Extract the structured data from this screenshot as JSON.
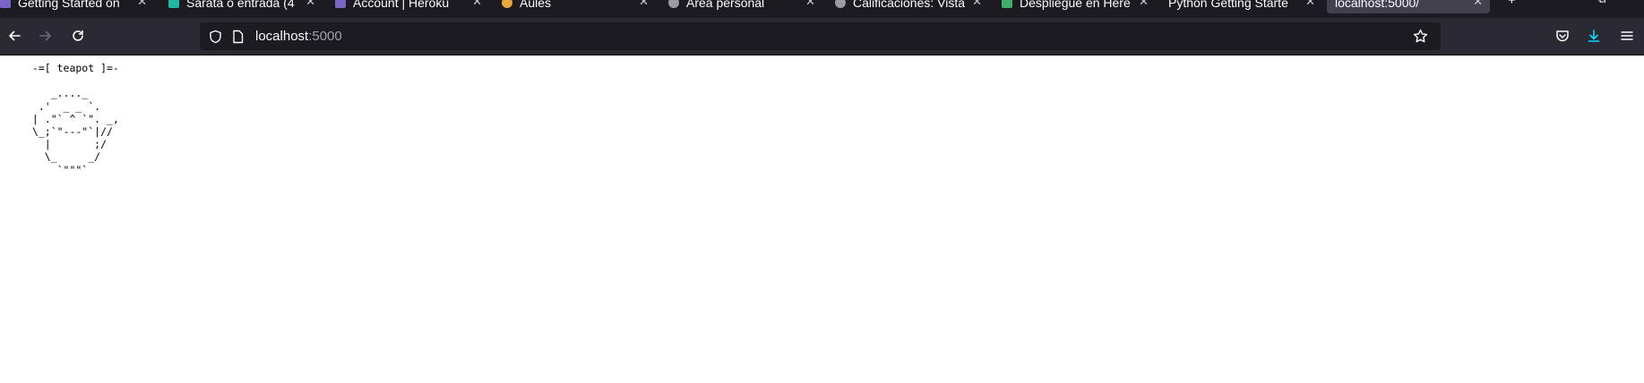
{
  "browser": {
    "tabs": [
      {
        "title": "Getting Started on",
        "favicon_color": "#7b63c7"
      },
      {
        "title": "Sarata o entrada (4",
        "favicon_color": "#22b5a0"
      },
      {
        "title": "Account | Heroku",
        "favicon_color": "#7b63c7"
      },
      {
        "title": "Aules",
        "favicon_color": "#e8a93c"
      },
      {
        "title": "Àrea personal",
        "favicon_color": "#9b9ba5"
      },
      {
        "title": "Calificaciones: Vista",
        "favicon_color": "#9b9ba5"
      },
      {
        "title": "Despliegue en Here",
        "favicon_color": "#3fae6a"
      },
      {
        "title": "Python Getting Starte",
        "favicon_color": ""
      },
      {
        "title": "localhost:5000/",
        "favicon_color": "",
        "active": true
      }
    ],
    "new_tab_label": "+",
    "url": {
      "host": "localhost",
      "port": ":5000"
    },
    "colors": {
      "download_accent": "#00ddff"
    }
  },
  "page": {
    "teapot_art": " -=[ teapot ]=-\n\n    _...._\n  .'  _ _ `.\n | .\"` ^ `\". _,\n \\_;`\"---\"`|//\n   |       ;/\n   \\_     _/\n     `\"\"\"`"
  }
}
